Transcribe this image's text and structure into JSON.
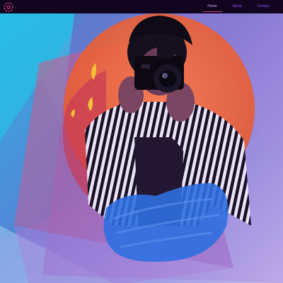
{
  "logo": {
    "icon": "flower-logo-icon",
    "color": "#d6406f"
  },
  "nav": {
    "items": [
      {
        "label": "Home",
        "active": true
      },
      {
        "label": "About",
        "active": false
      },
      {
        "label": "Contact",
        "active": false
      }
    ]
  },
  "colors": {
    "nav_bg": "#120520",
    "nav_link": "#8a4fff",
    "nav_link_active": "#c9a3ff",
    "accent_underline": "#c2477a",
    "panel_cyan": "#1fb4e0",
    "panel_purple": "#7d5bd6",
    "sun_orange": "#ff6a3d",
    "brush_blue": "#2f6fe0"
  }
}
